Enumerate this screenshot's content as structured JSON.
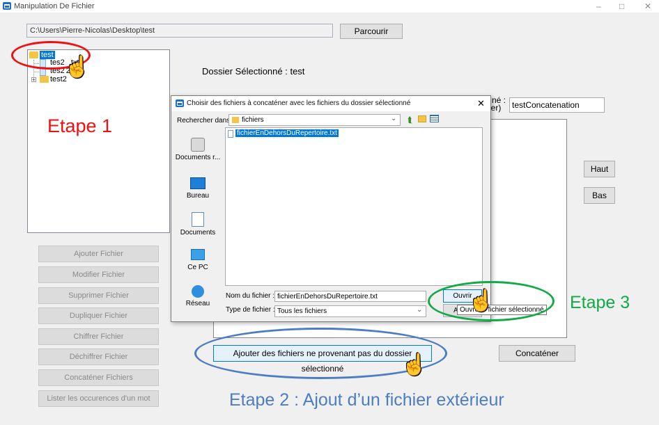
{
  "window": {
    "title": "Manipulation De Fichier",
    "controls": [
      "–",
      "□",
      "✕"
    ]
  },
  "main": {
    "path_value": "C:\\Users\\Pierre-Nicolas\\Desktop\\test",
    "browse_label": "Parcourir",
    "selected_folder_label": "Dossier Sélectionné : test",
    "tree": {
      "root": "test",
      "items": [
        "tes2",
        ".txt",
        "tes2",
        "2.txt",
        "test2"
      ]
    },
    "side_buttons": [
      "Ajouter Fichier",
      "Modifier Fichier",
      "Supprimer Fichier",
      "Dupliquer Fichier",
      "Chiffrer Fichier",
      "Déchiffrer Fichier",
      "Concaténer Fichiers",
      "Lister les occurences d'un mot"
    ],
    "partial_label_line1": "né :",
    "partial_label_line2": "ier)",
    "concat_name_value": "testConcatenation",
    "up_label": "Haut",
    "down_label": "Bas",
    "add_external_label": "Ajouter des fichiers ne provenant pas du dossier sélectionné",
    "concat_button_label": "Concaténer",
    "hidden_button_fragment": "A"
  },
  "annotations": {
    "step1": "Etape 1",
    "step2": "Etape 2 : Ajout d’un fichier extérieur",
    "step3": "Etape 3"
  },
  "dialog": {
    "title": "Choisir des fichiers à concaténer avec les fichiers du dossier sélectionné",
    "look_in_label": "Rechercher dans :",
    "look_in_value": "fichiers",
    "places": [
      "Documents r...",
      "Bureau",
      "Documents",
      "Ce PC",
      "Réseau"
    ],
    "files": [
      "fichierEnDehorsDuRepertoire.txt"
    ],
    "filename_label": "Nom du fichier :",
    "filename_value": "fichierEnDehorsDuRepertoire.txt",
    "filetype_label": "Type de fichier :",
    "filetype_value": "Tous les fichiers",
    "open_label": "Ouvrir",
    "open_tooltip": "Ouvre le fichier sélectionné"
  },
  "colors": {
    "annotation_red": "#ee1111",
    "annotation_green": "#11aa44",
    "annotation_blue": "#4c7dc2",
    "selection": "#0078d7"
  }
}
